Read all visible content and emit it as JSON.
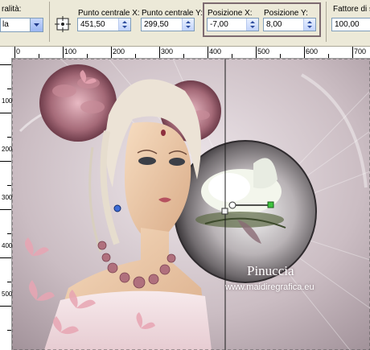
{
  "toolbar": {
    "quality_label": "ralità:",
    "quality_value": "la",
    "center_x_label": "Punto centrale X:",
    "center_x_value": "451,50",
    "center_y_label": "Punto centrale Y:",
    "center_y_value": "299,50",
    "pos_x_label": "Posizione X:",
    "pos_x_value": "-7,00",
    "pos_y_label": "Posizione Y:",
    "pos_y_value": "8,00",
    "scale_label": "Fattore di s",
    "scale_value": "100,00"
  },
  "ruler_top": {
    "ticks": [
      "0",
      "100",
      "200",
      "300",
      "400",
      "500",
      "600",
      "700"
    ]
  },
  "ruler_left": {
    "ticks": [
      {
        "label": "100"
      },
      {
        "label": "200"
      },
      {
        "label": "300"
      },
      {
        "label": "400"
      },
      {
        "label": "500"
      }
    ]
  },
  "canvas": {
    "watermark_name": "Pinuccia",
    "watermark_url": "www.maidiregrafica.eu"
  },
  "colors": {
    "highlight": "#7d6a70",
    "ruler_bg": "#ffffff",
    "panel_bg": "#ece9d8"
  },
  "icons": [
    "dropdown-arrow-icon",
    "center-point-icon",
    "spinner-arrows-icon"
  ]
}
